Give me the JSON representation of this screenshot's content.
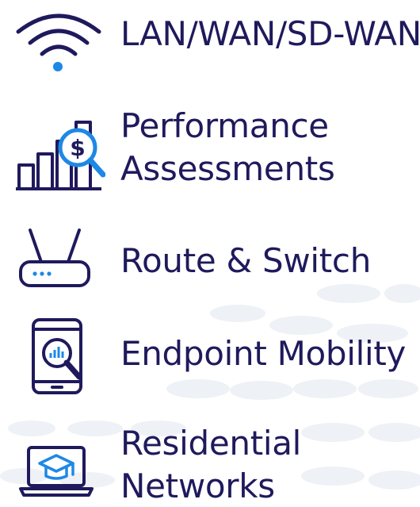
{
  "colors": {
    "text": "#1f1a5c",
    "icon_primary": "#1f1a5c",
    "icon_accent": "#1e88e5",
    "background": "#ffffff",
    "background_dots": "#eef1f5"
  },
  "items": [
    {
      "icon": "wifi-icon",
      "lines": [
        "LAN/WAN/SD-WAN"
      ]
    },
    {
      "icon": "bar-chart-dollar-magnifier-icon",
      "lines": [
        "Performance",
        "Assessments"
      ]
    },
    {
      "icon": "router-icon",
      "lines": [
        "Route & Switch"
      ]
    },
    {
      "icon": "smartphone-magnifier-icon",
      "lines": [
        "Endpoint Mobility"
      ]
    },
    {
      "icon": "laptop-graduation-cap-icon",
      "lines": [
        "Residential",
        "Networks"
      ]
    }
  ]
}
